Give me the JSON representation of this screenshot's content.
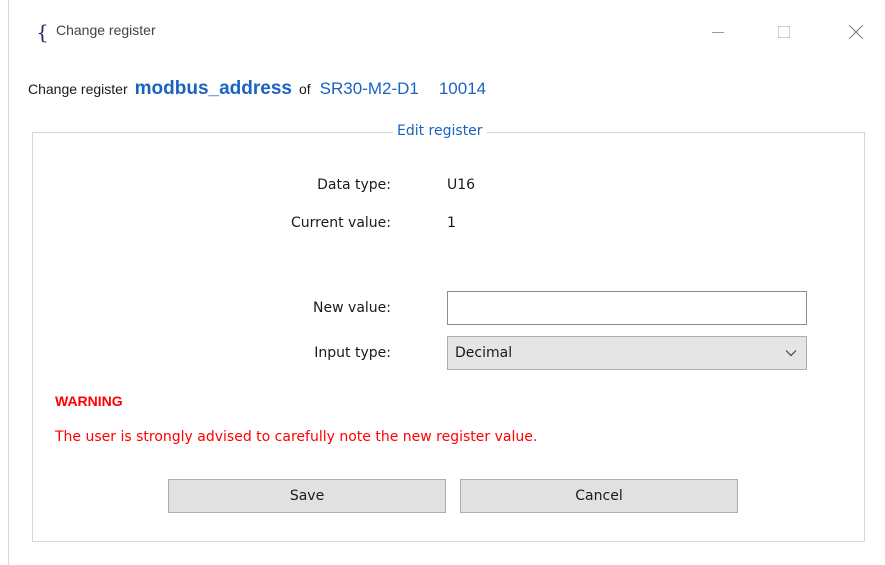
{
  "window": {
    "title": "Change register",
    "icon": "curly-brace-logo-icon"
  },
  "header": {
    "prefix": "Change register",
    "register_name": "modbus_address",
    "of_text": "of",
    "device": "SR30-M2-D1",
    "serial": "10014"
  },
  "group": {
    "legend": "Edit register",
    "data_type_label": "Data type:",
    "data_type_value": "U16",
    "current_value_label": "Current value:",
    "current_value": "1",
    "new_value_label": "New value:",
    "new_value_input": "",
    "input_type_label": "Input type:",
    "input_type_selected": "Decimal"
  },
  "warning": {
    "title": "WARNING",
    "text": "The user is strongly advised to carefully note the new register value."
  },
  "buttons": {
    "save": "Save",
    "cancel": "Cancel"
  },
  "colors": {
    "accent": "#1a63c1",
    "warning": "#ff0000",
    "button_bg": "#e1e1e1"
  }
}
